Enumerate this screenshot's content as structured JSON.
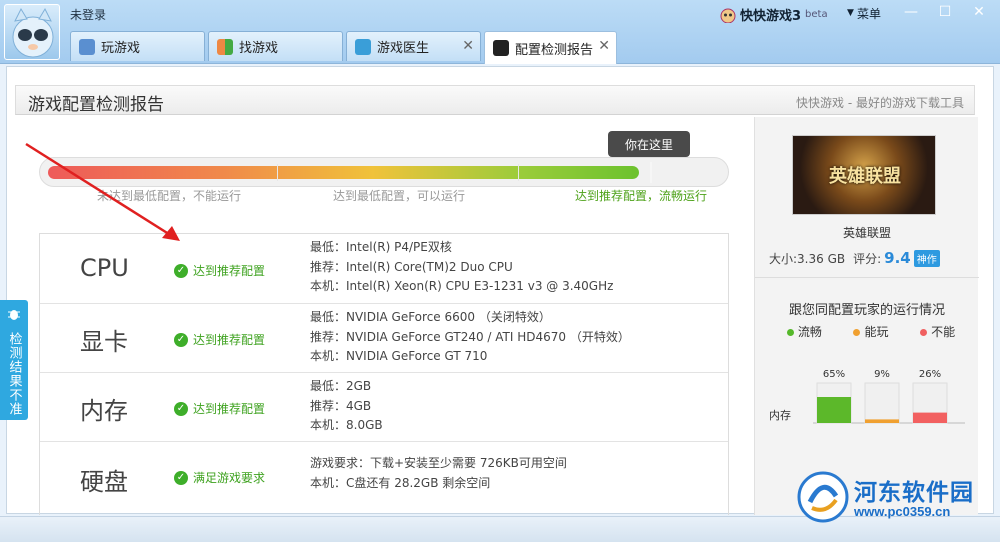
{
  "window": {
    "login_status": "未登录",
    "brand": "快快游戏3",
    "brand_tag": "beta",
    "menu_label": "菜单",
    "minimize": "—",
    "maximize": "☐",
    "close": "✕"
  },
  "tabs": [
    {
      "label": "玩游戏",
      "icon": "gamepad-icon",
      "closable": false,
      "active": false
    },
    {
      "label": "找游戏",
      "icon": "grid-icon",
      "closable": false,
      "active": false
    },
    {
      "label": "游戏医生",
      "icon": "medkit-icon",
      "closable": true,
      "active": false
    },
    {
      "label": "配置检测报告",
      "icon": "report-icon",
      "closable": true,
      "active": true
    }
  ],
  "tab_close": "✕",
  "header": {
    "title": "游戏配置检测报告",
    "slogan": "快快游戏 - 最好的游戏下载工具"
  },
  "progress": {
    "marker": "你在这里",
    "fraction": 0.88,
    "ticks": [
      "未达到最低配置，不能运行",
      "达到最低配置，可以运行",
      "达到推荐配置，流畅运行"
    ]
  },
  "rows": [
    {
      "name": "CPU",
      "status": "达到推荐配置",
      "specs": [
        "最低：Intel(R) P4/PE双核",
        "推荐：Intel(R) Core(TM)2 Duo CPU",
        "本机：Intel(R) Xeon(R) CPU E3-1231 v3 @ 3.40GHz"
      ]
    },
    {
      "name": "显卡",
      "status": "达到推荐配置",
      "specs": [
        "最低：NVIDIA GeForce 6600 （关闭特效）",
        "推荐：NVIDIA GeForce GT240 / ATI HD4670 （开特效）",
        "本机：NVIDIA GeForce GT 710"
      ]
    },
    {
      "name": "内存",
      "status": "达到推荐配置",
      "specs": [
        "最低：2GB",
        "推荐：4GB",
        "本机：8.0GB"
      ]
    },
    {
      "name": "硬盘",
      "status": "满足游戏要求",
      "specs": [
        "游戏要求：下载+安装至少需要 726KB可用空间",
        "本机：C盘还有 28.2GB 剩余空间"
      ]
    }
  ],
  "game": {
    "cover_text": "英雄联盟",
    "name": "英雄联盟",
    "size_label": "大小:3.36 GB",
    "score_label": "评分:",
    "score": "9.4",
    "badge": "神作"
  },
  "players": {
    "title": "跟您同配置玩家的运行情况",
    "legend": [
      {
        "label": "流畅",
        "color": "#55b82a"
      },
      {
        "label": "能玩",
        "color": "#f0a030"
      },
      {
        "label": "不能",
        "color": "#f06060"
      }
    ]
  },
  "chart_data": {
    "type": "bar",
    "categories": [
      "内存"
    ],
    "series": [
      {
        "name": "流畅",
        "values": [
          65
        ],
        "label": "65%",
        "color": "#5cb82a"
      },
      {
        "name": "能玩",
        "values": [
          9
        ],
        "label": "9%",
        "color": "#f0a030"
      },
      {
        "name": "不能",
        "values": [
          26
        ],
        "label": "26%",
        "color": "#f26060"
      }
    ],
    "ylim": [
      0,
      100
    ]
  },
  "side_tab": "检测结果不准",
  "watermark": {
    "name": "河东软件园",
    "url": "www.pc0359.cn"
  }
}
